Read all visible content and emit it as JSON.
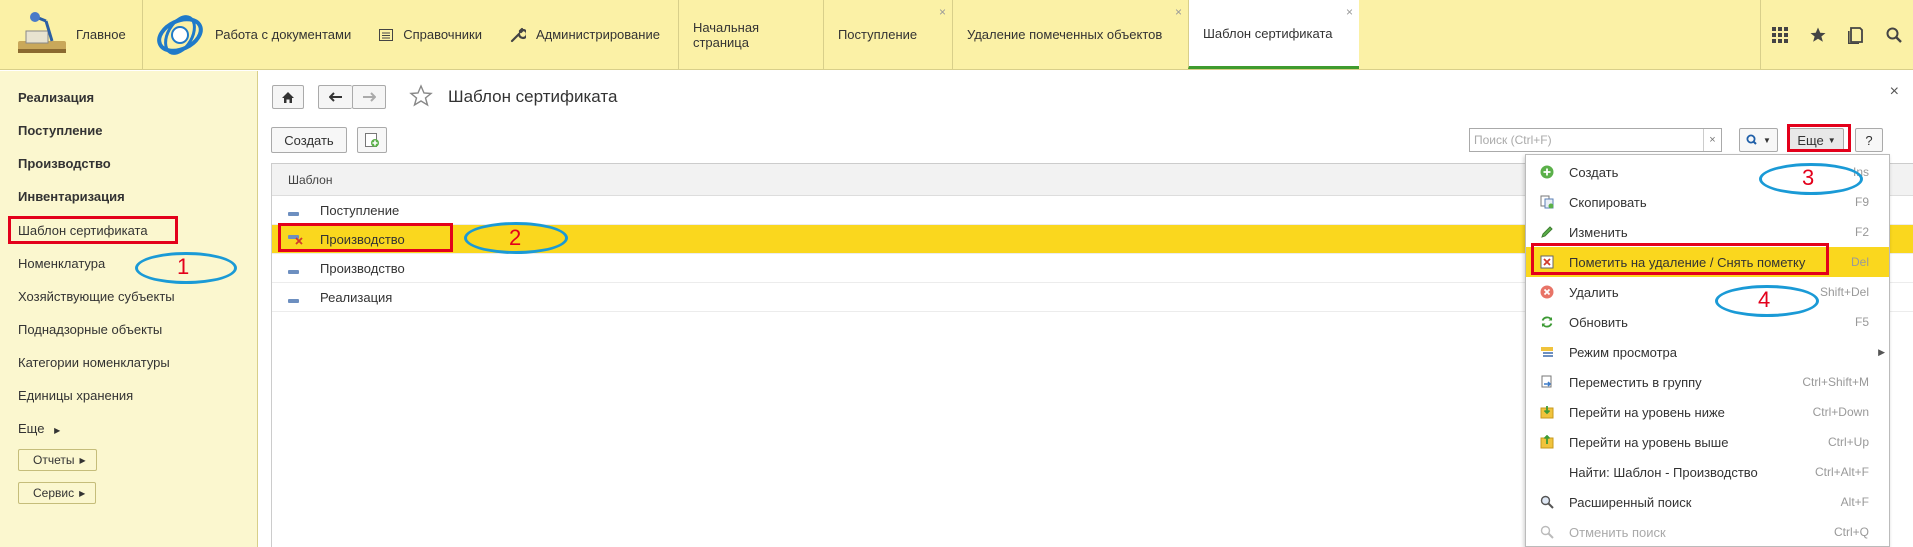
{
  "topbar": {
    "home_label": "Главное",
    "sections": [
      {
        "label": "Работа с документами",
        "icon": "1c-logo-icon"
      },
      {
        "label": "Справочники",
        "icon": "list-icon"
      },
      {
        "label": "Администрирование",
        "icon": "wrench-icon"
      }
    ],
    "tabs": [
      {
        "label": "Начальная страница",
        "closable": false
      },
      {
        "label": "Поступление",
        "closable": true
      },
      {
        "label": "Удаление помеченных объектов",
        "closable": true
      },
      {
        "label": "Шаблон сертификата",
        "closable": true,
        "active": true
      }
    ],
    "right_icons": [
      "apps-grid-icon",
      "star-icon",
      "history-icon",
      "search-icon"
    ]
  },
  "sidebar": {
    "bold_items": [
      "Реализация",
      "Поступление",
      "Производство",
      "Инвентаризация"
    ],
    "items": [
      "Шаблон сертификата",
      "Номенклатура",
      "Хозяйствующие субъекты",
      "Поднадзорные объекты",
      "Категории номенклатуры",
      "Единицы хранения"
    ],
    "more_label": "Еще",
    "buttons": [
      "Отчеты",
      "Сервис"
    ]
  },
  "main": {
    "title": "Шаблон сертификата",
    "create_label": "Создать",
    "search_placeholder": "Поиск (Ctrl+F)",
    "more_label": "Еще",
    "help_label": "?",
    "close_label": "×"
  },
  "table": {
    "header": "Шаблон",
    "rows": [
      {
        "label": "Поступление",
        "marked": false,
        "selected": false
      },
      {
        "label": "Производство",
        "marked": true,
        "selected": true
      },
      {
        "label": "Производство",
        "marked": false,
        "selected": false
      },
      {
        "label": "Реализация",
        "marked": false,
        "selected": false
      }
    ]
  },
  "context_menu": {
    "items": [
      {
        "label": "Создать",
        "shortcut": "Ins",
        "icon": "plus-circle-icon"
      },
      {
        "label": "Скопировать",
        "shortcut": "F9",
        "icon": "copy-icon"
      },
      {
        "label": "Изменить",
        "shortcut": "F2",
        "icon": "pencil-icon"
      },
      {
        "label": "Пометить на удаление / Снять пометку",
        "shortcut": "Del",
        "icon": "mark-delete-icon",
        "active": true
      },
      {
        "label": "Удалить",
        "shortcut": "Shift+Del",
        "icon": "delete-icon"
      },
      {
        "label": "Обновить",
        "shortcut": "F5",
        "icon": "refresh-icon"
      },
      {
        "label": "Режим просмотра",
        "shortcut": "",
        "icon": "view-mode-icon",
        "submenu": true
      },
      {
        "label": "Переместить в группу",
        "shortcut": "Ctrl+Shift+M",
        "icon": "move-group-icon"
      },
      {
        "label": "Перейти на уровень ниже",
        "shortcut": "Ctrl+Down",
        "icon": "level-down-icon"
      },
      {
        "label": "Перейти на уровень выше",
        "shortcut": "Ctrl+Up",
        "icon": "level-up-icon"
      },
      {
        "label": "Найти: Шаблон - Производство",
        "shortcut": "Ctrl+Alt+F",
        "icon": ""
      },
      {
        "label": "Расширенный поиск",
        "shortcut": "Alt+F",
        "icon": "search-icon"
      },
      {
        "label": "Отменить поиск",
        "shortcut": "Ctrl+Q",
        "icon": "cancel-search-icon",
        "disabled": true
      }
    ]
  },
  "annotations": [
    "1",
    "2",
    "3",
    "4"
  ],
  "colors": {
    "topbar_bg": "#fbf1a6",
    "sidebar_bg": "#fbf7cf",
    "selection": "#fad71e",
    "annotation_red": "#e3001b",
    "annotation_blue": "#1a9ad6",
    "active_tab_underline": "#3f9b2e"
  }
}
